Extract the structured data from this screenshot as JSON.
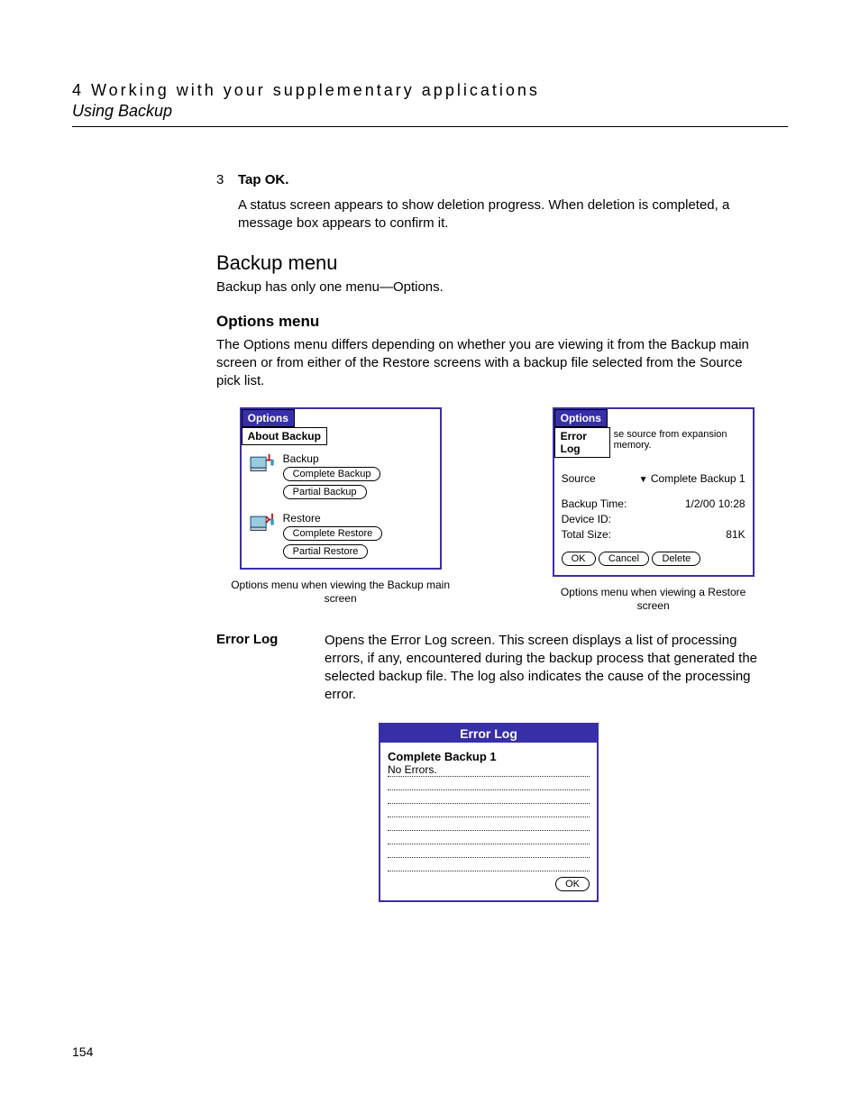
{
  "header": {
    "chapter": "4 Working with your supplementary applications",
    "section": "Using Backup"
  },
  "step3": {
    "num": "3",
    "text": "Tap OK."
  },
  "step3_body": "A status screen appears to show deletion progress. When deletion is completed, a message box appears to confirm it.",
  "h2_backup_menu": "Backup menu",
  "backup_menu_body": "Backup has only one menu—Options.",
  "h3_options": "Options menu",
  "options_body": "The Options menu differs depending on whether you are viewing it from the Backup main screen or from either of the Restore screens with a backup file selected from the Source pick list.",
  "fig1": {
    "menu_options": "Options",
    "menu_about": "About Backup",
    "lbl_backup": "Backup",
    "btn_complete_backup": "Complete Backup",
    "btn_partial_backup": "Partial Backup",
    "lbl_restore": "Restore",
    "btn_complete_restore": "Complete Restore",
    "btn_partial_restore": "Partial Restore",
    "caption1": "Options menu when viewing the Backup main screen"
  },
  "fig2": {
    "menu_options": "Options",
    "menu_errorlog": "Error Log",
    "hint": "se source from expansion memory.",
    "lbl_source": "Source",
    "val_source": "Complete Backup 1",
    "lbl_bktime": "Backup Time:",
    "val_bktime": "1/2/00 10:28",
    "lbl_devid": "Device ID:",
    "lbl_total": "Total Size:",
    "val_total": "81K",
    "btn_ok": "OK",
    "btn_cancel": "Cancel",
    "btn_delete": "Delete",
    "caption2": "Options menu when viewing a Restore screen"
  },
  "def": {
    "term": "Error Log",
    "desc": "Opens the Error Log screen. This screen displays a list of processing errors, if any, encountered during the backup process that generated the selected backup file. The log also indicates the cause of the processing error."
  },
  "errlog": {
    "title": "Error Log",
    "sub": "Complete Backup 1",
    "row0": "No Errors.",
    "btn_ok": "OK"
  },
  "page_num": "154"
}
